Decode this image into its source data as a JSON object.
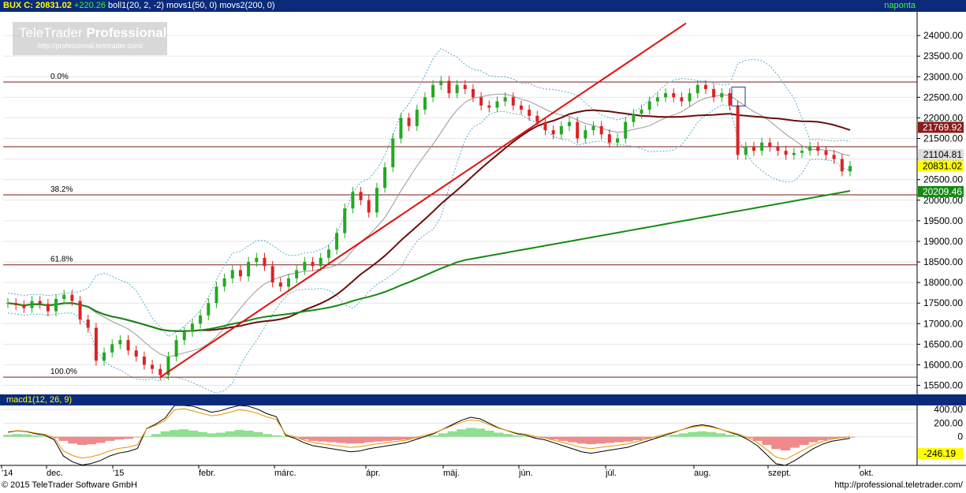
{
  "header": {
    "symbol": "BUX",
    "close_label": "C: 20831.02",
    "change": "+220.26",
    "indicators": "boll1(20, 2, -2) movs1(50, 0) movs2(200, 0)",
    "period": "naponta"
  },
  "logo": {
    "brand_light": "TeleTrader ",
    "brand_bold": "Professional",
    "url": "http://professional.teletrader.com/"
  },
  "subpanel": {
    "title": "macd1(12, 26, 9)"
  },
  "footer": {
    "copyright": "© 2015 TeleTrader Software GmbH",
    "url": "http://professional.teletrader.com/"
  },
  "colors": {
    "up": "#22aa22",
    "down": "#dd2222",
    "ma50": "#6b0e0e",
    "ma200": "#138a13",
    "trend": "#e01010",
    "boll": "#55aacc",
    "macd_pos": "#8ee08e",
    "macd_neg": "#f08a8a"
  },
  "chart_data": [
    {
      "type": "candlestick",
      "ylim": [
        15300,
        24500
      ],
      "y_ticks": [
        "24000.00",
        "23500.00",
        "23000.00",
        "22500.00",
        "22000.00",
        "21500.00",
        "21000.00",
        "20500.00",
        "20000.00",
        "19500.00",
        "19000.00",
        "18500.00",
        "18000.00",
        "17500.00",
        "17000.00",
        "16500.00",
        "16000.00",
        "15500.00"
      ],
      "x_labels": [
        "'14",
        "dec.",
        "'15",
        "febr.",
        "márc.",
        "ápr.",
        "máj.",
        "jún.",
        "júl.",
        "aug.",
        "szept.",
        "okt."
      ],
      "price_labels": [
        {
          "text": "21769.92",
          "value": 21769.92,
          "color": "#8b1a1a"
        },
        {
          "text": "21104.81",
          "value": 21104.81,
          "color": "#dddddd"
        },
        {
          "text": "20831.02",
          "value": 20831.02,
          "color": "#ffff00"
        },
        {
          "text": "20209.46",
          "value": 20209.46,
          "color": "#138a13"
        }
      ],
      "fib_levels": [
        {
          "text": "0.0%",
          "value": 22870
        },
        {
          "text": "38.2%",
          "value": 20130
        },
        {
          "text": "61.8%",
          "value": 18430
        },
        {
          "text": "100.0%",
          "value": 15700
        }
      ],
      "hlines": [
        22870,
        21300,
        20130,
        18430,
        15700
      ],
      "close_series": [
        17500,
        17450,
        17380,
        17550,
        17480,
        17300,
        17600,
        17700,
        17550,
        17100,
        16900,
        16100,
        16300,
        16500,
        16600,
        16350,
        16200,
        16000,
        15900,
        15750,
        16200,
        16600,
        16800,
        17000,
        17200,
        17500,
        17900,
        18100,
        18300,
        18150,
        18500,
        18600,
        18400,
        18000,
        17900,
        18100,
        18300,
        18500,
        18400,
        18600,
        18800,
        19200,
        19800,
        20200,
        20000,
        19700,
        20300,
        20800,
        21500,
        22000,
        21800,
        22200,
        22500,
        22800,
        22900,
        22600,
        22800,
        22700,
        22500,
        22300,
        22250,
        22400,
        22500,
        22300,
        22200,
        22050,
        21900,
        21700,
        21600,
        21800,
        21900,
        21500,
        21700,
        21800,
        21600,
        21400,
        21500,
        21900,
        22100,
        22200,
        22400,
        22500,
        22600,
        22500,
        22400,
        22600,
        22800,
        22700,
        22500,
        22600,
        22300,
        21100,
        21300,
        21200,
        21400,
        21300,
        21200,
        21100,
        21150,
        21200,
        21300,
        21200,
        21100,
        21000,
        20700,
        20831.02
      ],
      "ma50_end": 21769.92,
      "ma200_end": 20209.46
    },
    {
      "type": "bar",
      "title": "macd1(12, 26, 9)",
      "ylim": [
        -420,
        460
      ],
      "y_ticks": [
        "400.00",
        "200.00",
        "0"
      ],
      "last_value_label": "-246.19",
      "histogram": [
        30,
        40,
        35,
        20,
        10,
        -20,
        -60,
        -100,
        -120,
        -110,
        -90,
        -60,
        -40,
        -30,
        -10,
        10,
        40,
        80,
        100,
        110,
        90,
        70,
        50,
        60,
        80,
        100,
        90,
        70,
        40,
        20,
        10,
        -10,
        -40,
        -60,
        -70,
        -80,
        -90,
        -100,
        -95,
        -80,
        -70,
        -60,
        -50,
        -40,
        -20,
        0,
        20,
        50,
        80,
        110,
        130,
        120,
        90,
        60,
        40,
        20,
        10,
        -10,
        -20,
        -40,
        -60,
        -80,
        -100,
        -110,
        -100,
        -90,
        -80,
        -70,
        -50,
        -30,
        -10,
        10,
        30,
        50,
        70,
        80,
        70,
        50,
        30,
        10,
        -20,
        -60,
        -120,
        -180,
        -200,
        -160,
        -120,
        -80,
        -50,
        -30,
        -20,
        -10
      ]
    }
  ]
}
